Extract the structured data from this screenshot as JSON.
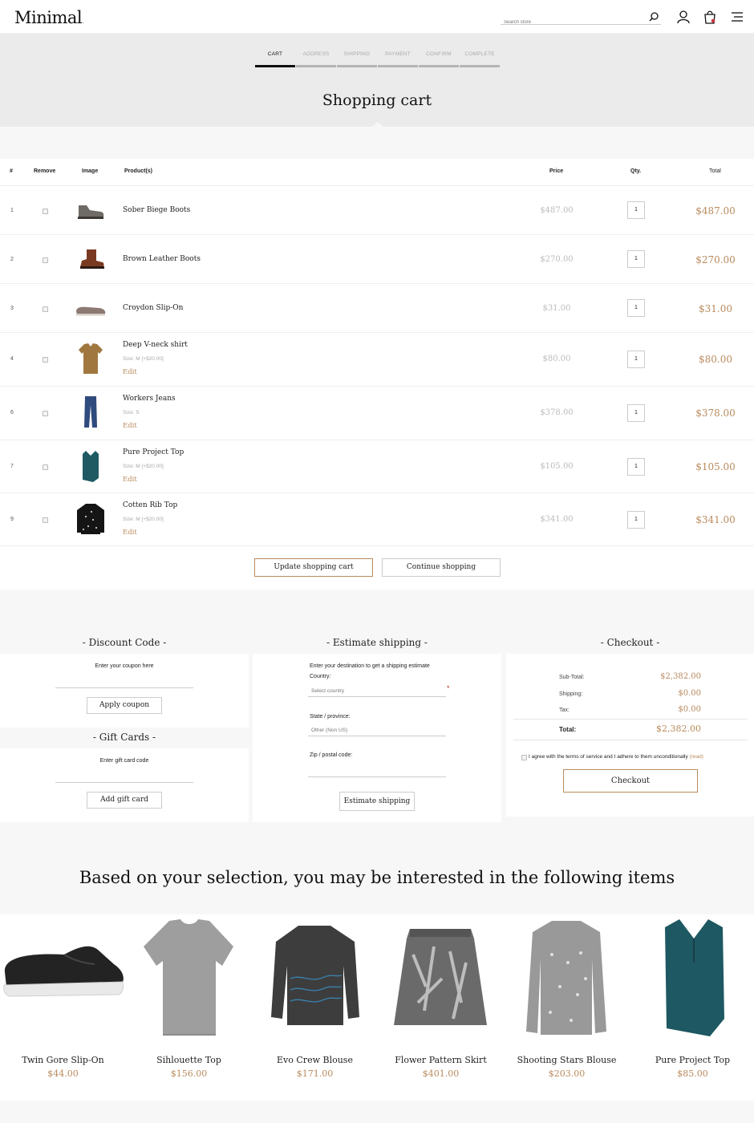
{
  "brand": {
    "logo": "Minimal",
    "logo_dot": "."
  },
  "search": {
    "placeholder": "Search store"
  },
  "steps": [
    "CART",
    "ADDRESS",
    "SHIPPING",
    "PAYMENT",
    "CONFIRM",
    "COMPLETE"
  ],
  "active_step": "CART",
  "page_title": "Shopping cart",
  "table": {
    "headers": {
      "num": "#",
      "remove": "Remove",
      "image": "Image",
      "products": "Product(s)",
      "price": "Price",
      "qty": "Qty.",
      "total": "Total"
    }
  },
  "cart_items": [
    {
      "num": "1",
      "name": "Sober Biege Boots",
      "size": "",
      "edit": "",
      "price": "$487.00",
      "qty": "1",
      "total": "$487.00",
      "icon": "boot-icon"
    },
    {
      "num": "2",
      "name": "Brown Leather Boots",
      "size": "",
      "edit": "",
      "price": "$270.00",
      "qty": "1",
      "total": "$270.00",
      "icon": "boot-icon"
    },
    {
      "num": "3",
      "name": "Croydon Slip-On",
      "size": "",
      "edit": "",
      "price": "$31.00",
      "qty": "1",
      "total": "$31.00",
      "icon": "slip-on-icon"
    },
    {
      "num": "4",
      "name": "Deep V-neck shirt",
      "size": "Size: M [+$20.00]",
      "edit": "Edit",
      "price": "$80.00",
      "qty": "1",
      "total": "$80.00",
      "icon": "tshirt-icon"
    },
    {
      "num": "6",
      "name": "Workers Jeans",
      "size": "Size: S",
      "edit": "Edit",
      "price": "$378.00",
      "qty": "1",
      "total": "$378.00",
      "icon": "jeans-icon"
    },
    {
      "num": "7",
      "name": "Pure Project Top",
      "size": "Size: M [+$20.00]",
      "edit": "Edit",
      "price": "$105.00",
      "qty": "1",
      "total": "$105.00",
      "icon": "top-icon"
    },
    {
      "num": "9",
      "name": "Cotten Rib Top",
      "size": "Size: M [+$20.00]",
      "edit": "Edit",
      "price": "$341.00",
      "qty": "1",
      "total": "$341.00",
      "icon": "sweater-icon"
    }
  ],
  "cart_buttons": {
    "update": "Update shopping cart",
    "continue": "Continue shopping"
  },
  "discount": {
    "title": "- Discount Code -",
    "label": "Enter your coupon here",
    "button": "Apply coupon"
  },
  "gift": {
    "title": "- Gift Cards -",
    "label": "Enter gift card code",
    "button": "Add gift card"
  },
  "shipping": {
    "title": "- Estimate shipping -",
    "intro": "Enter your destination to get a shipping estimate",
    "country_label": "Country:",
    "country_value": "Select country",
    "required_mark": "*",
    "state_label": "State / province:",
    "state_value": "Other (Non US)",
    "zip_label": "Zip / postal code:",
    "button": "Estimate shipping"
  },
  "checkout": {
    "title": "- Checkout -",
    "subtotal_label": "Sub-Total:",
    "subtotal": "$2,382.00",
    "shipping_label": "Shipping:",
    "shipping": "$0.00",
    "tax_label": "Tax:",
    "tax": "$0.00",
    "total_label": "Total:",
    "total": "$2,382.00",
    "terms": "I agree with the terms of service and I adhere to them unconditionally",
    "terms_link": "(read)",
    "button": "Checkout"
  },
  "recommendations": {
    "title": "Based on your selection, you may be interested in the following items",
    "items": [
      {
        "name": "Twin Gore Slip-On",
        "price": "$44.00",
        "icon": "sneaker-icon"
      },
      {
        "name": "Sihlouette Top",
        "price": "$156.00",
        "icon": "tshirt-icon"
      },
      {
        "name": "Evo Crew Blouse",
        "price": "$171.00",
        "icon": "sweater-icon"
      },
      {
        "name": "Flower Pattern Skirt",
        "price": "$401.00",
        "icon": "skirt-icon"
      },
      {
        "name": "Shooting Stars Blouse",
        "price": "$203.00",
        "icon": "sweater-icon"
      },
      {
        "name": "Pure Project Top",
        "price": "$85.00",
        "icon": "top-icon"
      }
    ]
  },
  "colors": {
    "accent": "#b98a5d",
    "band": "#ebebeb",
    "page": "#f7f7f7"
  }
}
